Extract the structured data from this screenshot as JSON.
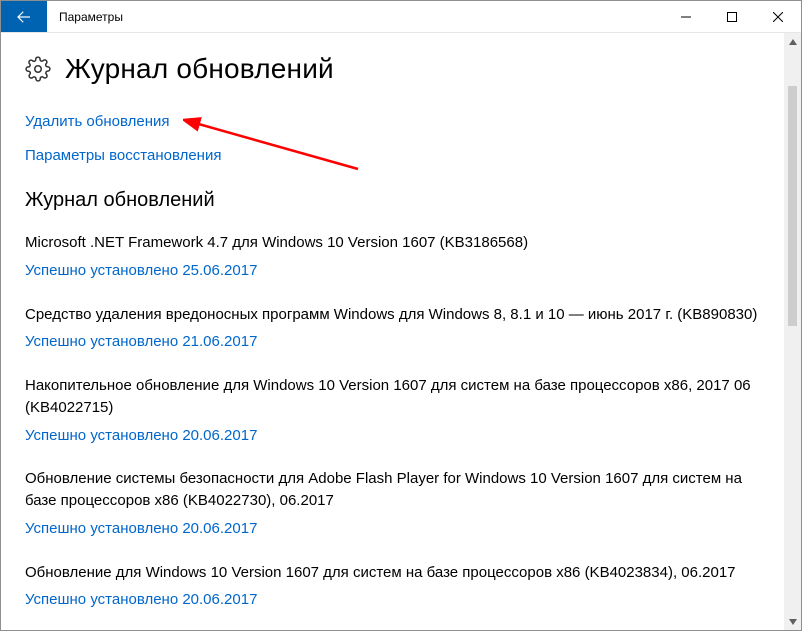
{
  "window": {
    "title": "Параметры"
  },
  "page": {
    "heading": "Журнал обновлений"
  },
  "links": {
    "uninstall": "Удалить обновления",
    "recovery": "Параметры восстановления"
  },
  "section": {
    "heading": "Журнал обновлений"
  },
  "updates": [
    {
      "title": "Microsoft .NET Framework 4.7 для Windows 10 Version 1607 (KB3186568)",
      "status": "Успешно установлено 25.06.2017"
    },
    {
      "title": "Средство удаления вредоносных программ Windows для Windows 8, 8.1 и 10 — июнь 2017 г. (KB890830)",
      "status": "Успешно установлено 21.06.2017"
    },
    {
      "title": "Накопительное обновление для Windows 10 Version 1607 для систем на базе процессоров x86, 2017 06 (KB4022715)",
      "status": "Успешно установлено 20.06.2017"
    },
    {
      "title": "Обновление системы безопасности для Adobe Flash Player for Windows 10 Version 1607 для систем на базе процессоров x86 (KB4022730), 06.2017",
      "status": "Успешно установлено 20.06.2017"
    },
    {
      "title": "Обновление для Windows 10 Version 1607 для систем на базе процессоров x86 (KB4023834), 06.2017",
      "status": "Успешно установлено 20.06.2017"
    }
  ]
}
